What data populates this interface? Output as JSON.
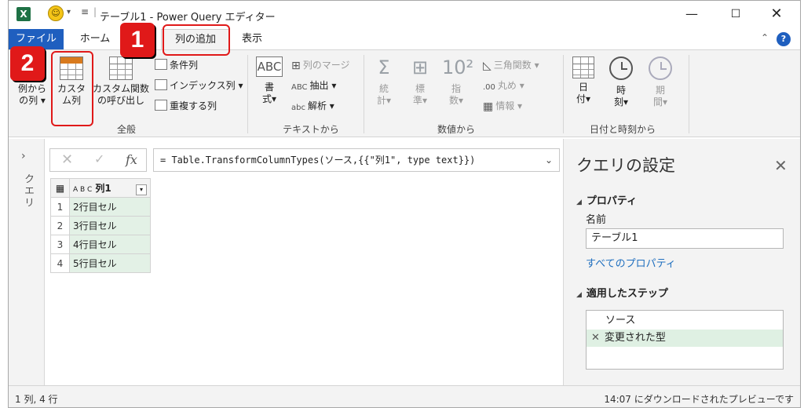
{
  "window": {
    "title": "テーブル1 - Power Query エディター",
    "minimize": "—",
    "maximize": "☐",
    "close": "✕"
  },
  "tabs": {
    "file": "ファイル",
    "home": "ホーム",
    "add_column": "列の追加",
    "view": "表示",
    "help": "?"
  },
  "ribbon": {
    "general": {
      "label": "全般",
      "column_from_examples": [
        "例から",
        "の列 ▾"
      ],
      "custom_column": [
        "カスタ",
        "ム列"
      ],
      "invoke_custom_function": [
        "カスタム関数",
        "の呼び出し"
      ],
      "conditional_column": "条件列",
      "index_column": "インデックス列 ▾",
      "duplicate_column": "重複する列"
    },
    "text": {
      "label": "テキストから",
      "format": [
        "書",
        "式▾"
      ],
      "merge_columns": "列のマージ",
      "extract": "抽出 ▾",
      "parse": "解析 ▾",
      "abc_icon": "ABC"
    },
    "number": {
      "label": "数値から",
      "statistics": [
        "統",
        "計▾"
      ],
      "standard": [
        "標",
        "準▾"
      ],
      "scientific": [
        "指",
        "数▾"
      ],
      "trigonometry": "三角関数 ▾",
      "rounding": "丸め ▾",
      "information": "情報 ▾"
    },
    "datetime": {
      "label": "日付と時刻から",
      "date": [
        "日",
        "付▾"
      ],
      "time": [
        "時",
        "刻▾"
      ],
      "duration": [
        "期",
        "間▾"
      ]
    }
  },
  "annotations": {
    "step1": "1",
    "step2": "2",
    "colors": {
      "red": "#e01919"
    }
  },
  "queries_pane": {
    "label": "クエリ",
    "expand": "›"
  },
  "formula_bar": {
    "formula": "= Table.TransformColumnTypes(ソース,{{\"列1\", type text}})",
    "cancel": "✕",
    "confirm": "✓",
    "fx": "fx"
  },
  "grid": {
    "column_header": "列1",
    "type_icon": "A B C",
    "rows": [
      {
        "n": "1",
        "v": "2行目セル"
      },
      {
        "n": "2",
        "v": "3行目セル"
      },
      {
        "n": "3",
        "v": "4行目セル"
      },
      {
        "n": "4",
        "v": "5行目セル"
      }
    ]
  },
  "settings": {
    "title": "クエリの設定",
    "properties": "プロパティ",
    "name_label": "名前",
    "name_value": "テーブル1",
    "all_properties": "すべてのプロパティ",
    "applied_steps": "適用したステップ",
    "steps": [
      "ソース",
      "変更された型"
    ]
  },
  "status": {
    "left": "1 列, 4 行",
    "right": "14:07 にダウンロードされたプレビューです"
  }
}
